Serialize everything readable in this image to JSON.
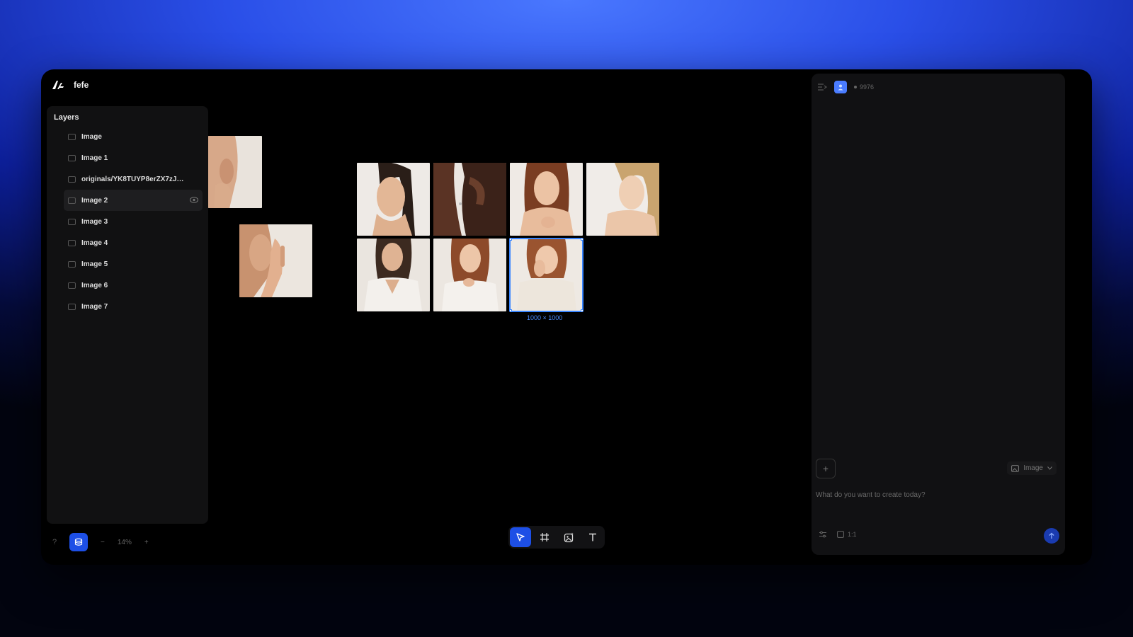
{
  "header": {
    "project_name": "fefe",
    "logo_icon": "app-logo-icon"
  },
  "layers": {
    "title": "Layers",
    "items": [
      {
        "label": "Image",
        "icon": "image-icon"
      },
      {
        "label": "Image 1",
        "icon": "image-icon"
      },
      {
        "label": "originals/YK8TUYP8erZX7zJEG...",
        "icon": "image-icon"
      },
      {
        "label": "Image 2",
        "icon": "image-icon",
        "active": true,
        "trailing_icon": "eye-icon"
      },
      {
        "label": "Image 3",
        "icon": "image-icon"
      },
      {
        "label": "Image 4",
        "icon": "image-icon"
      },
      {
        "label": "Image 5",
        "icon": "image-icon"
      },
      {
        "label": "Image 6",
        "icon": "image-icon"
      },
      {
        "label": "Image 7",
        "icon": "image-icon"
      }
    ]
  },
  "canvas": {
    "selection_size": "1000 × 1000"
  },
  "zoom": {
    "minus": "−",
    "value": "14%",
    "plus": "+"
  },
  "help": "?",
  "toolbar": {
    "tools": [
      "select-tool",
      "frame-tool",
      "image-generate-tool",
      "text-tool"
    ],
    "active": "select-tool"
  },
  "chat": {
    "credits": "9976",
    "mode": "Image",
    "prompt_placeholder": "What do you want to create today?",
    "aspect_ratio": "1:1"
  },
  "colors": {
    "accent": "#1d4fe6",
    "selection": "#3a86ff"
  }
}
